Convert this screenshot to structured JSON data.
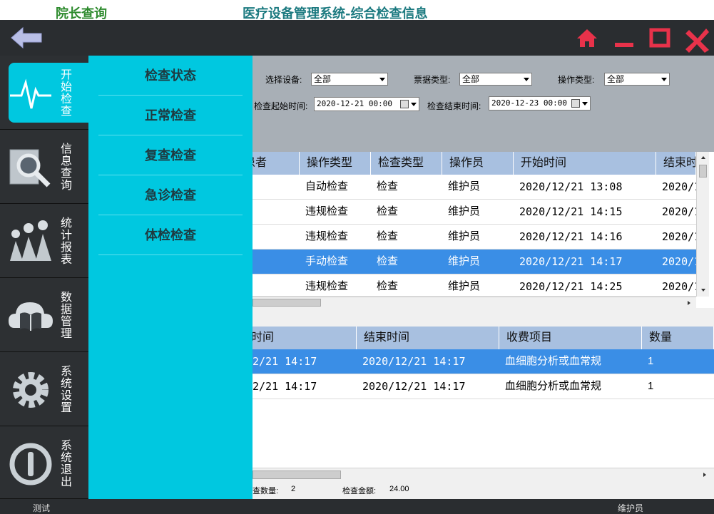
{
  "window": {
    "app_name": "院长查询",
    "title": "医疗设备管理系统-综合检查信息"
  },
  "colors": {
    "accent": "#00c8e0",
    "window_button": "#e8324a",
    "selection": "#3a8ee6",
    "header": "#a8c0e0"
  },
  "toolbar": {
    "back_icon": "arrow-left-icon",
    "home_icon": "home-icon",
    "minimize_icon": "minimize-icon",
    "maximize_icon": "maximize-icon",
    "close_icon": "close-icon"
  },
  "sidebar": {
    "items": [
      {
        "label": "开始检查",
        "icon": "heartbeat-icon",
        "active": true
      },
      {
        "label": "信息查询",
        "icon": "magnifier-icon",
        "active": false
      },
      {
        "label": "统计报表",
        "icon": "people-chart-icon",
        "active": false
      },
      {
        "label": "数据管理",
        "icon": "cloud-book-icon",
        "active": false
      },
      {
        "label": "系统设置",
        "icon": "gear-icon",
        "active": false
      },
      {
        "label": "系统退出",
        "icon": "power-icon",
        "active": false
      }
    ]
  },
  "submenu": {
    "items": [
      "检查状态",
      "正常检查",
      "复查检查",
      "急诊检查",
      "体检检查"
    ]
  },
  "filters": {
    "device_label": "选择设备:",
    "device_value": "全部",
    "ticket_label": "票据类型:",
    "ticket_value": "全部",
    "operation_label": "操作类型:",
    "operation_value": "全部",
    "start_label": "检查起始时间:",
    "start_value": "2020-12-21 00:00",
    "end_label": "检查结束时间:",
    "end_value": "2020-12-23 00:00"
  },
  "main_table": {
    "headers": [
      "患者",
      "操作类型",
      "检查类型",
      "操作员",
      "开始时间",
      "结束时"
    ],
    "rows": [
      {
        "patient": "-",
        "op_type": "自动检查",
        "exam_type": "检查",
        "operator": "维护员",
        "start": "2020/12/21 13:08",
        "end": "2020/1",
        "selected": false
      },
      {
        "patient": "",
        "op_type": "违规检查",
        "exam_type": "检查",
        "operator": "维护员",
        "start": "2020/12/21 14:15",
        "end": "2020/1",
        "selected": false
      },
      {
        "patient": "",
        "op_type": "违规检查",
        "exam_type": "检查",
        "operator": "维护员",
        "start": "2020/12/21 14:16",
        "end": "2020/1",
        "selected": false
      },
      {
        "patient": "",
        "op_type": "手动检查",
        "exam_type": "检查",
        "operator": "维护员",
        "start": "2020/12/21 14:17",
        "end": "2020/1",
        "selected": true
      },
      {
        "patient": "",
        "op_type": "违规检查",
        "exam_type": "检查",
        "operator": "维护员",
        "start": "2020/12/21 14:25",
        "end": "2020/1",
        "selected": false
      }
    ]
  },
  "detail_table": {
    "headers": [
      "时间",
      "结束时间",
      "收费项目",
      "数量"
    ],
    "rows": [
      {
        "start": "2/21 14:17",
        "end": "2020/12/21 14:17",
        "item": "血细胞分析或血常规",
        "qty": "1",
        "selected": true
      },
      {
        "start": "2/21 14:17",
        "end": "2020/12/21 14:17",
        "item": "血细胞分析或血常规",
        "qty": "1",
        "selected": false
      }
    ]
  },
  "totals": {
    "count_label": "查数量:",
    "count_value": "2",
    "amount_label": "检查金额:",
    "amount_value": "24.00"
  },
  "status": {
    "left": "测试",
    "right": "维护员"
  }
}
